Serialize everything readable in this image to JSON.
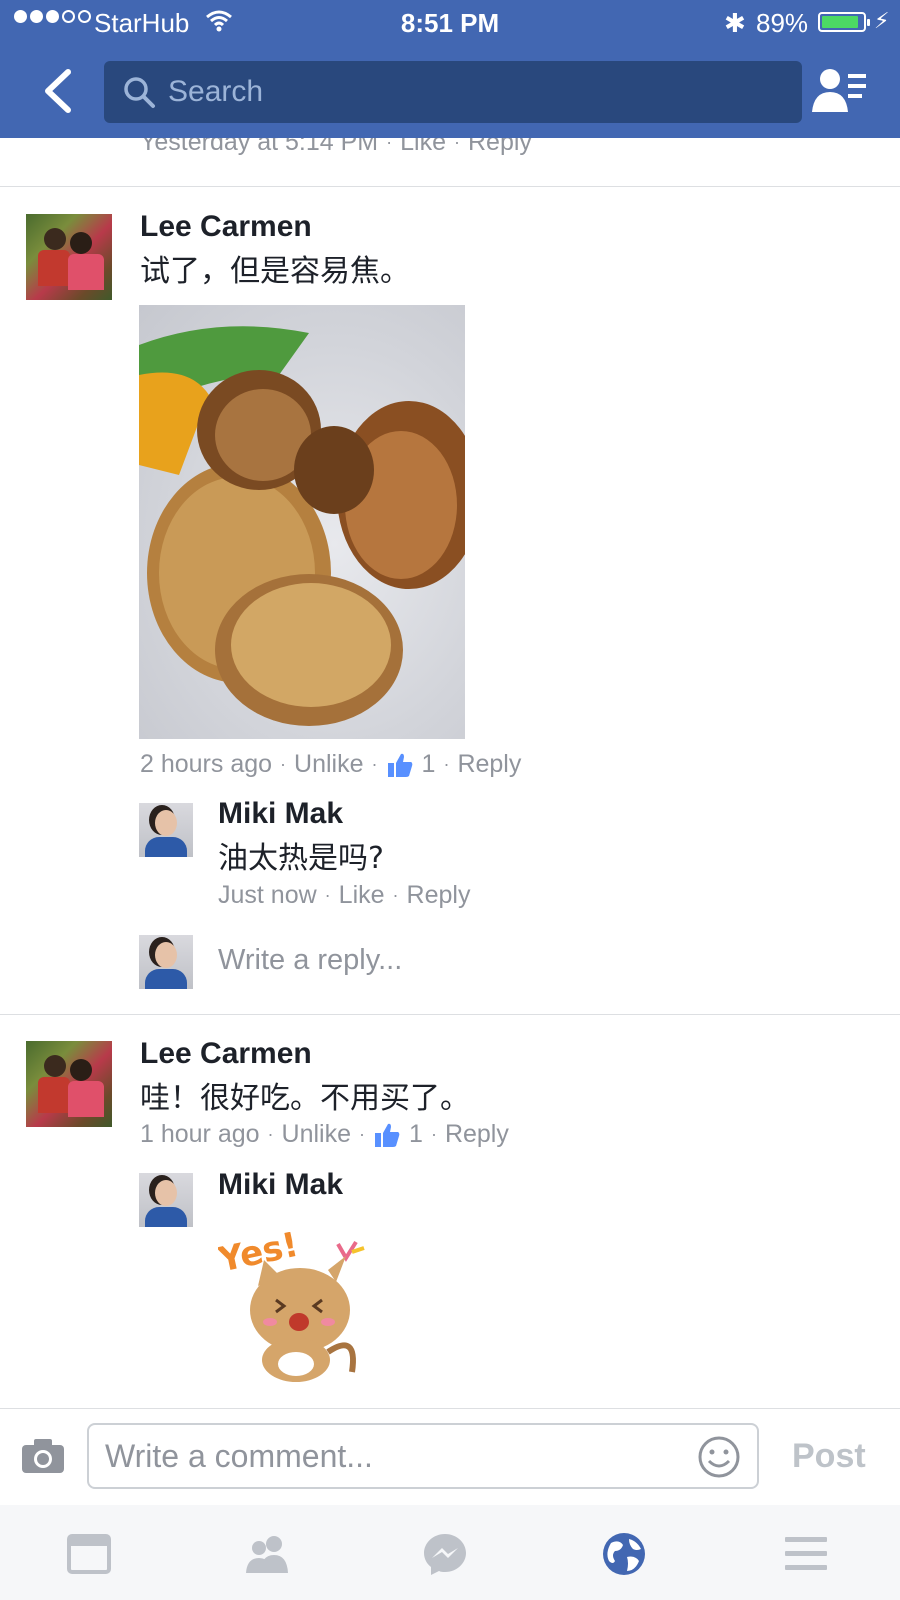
{
  "status_bar": {
    "carrier": "StarHub",
    "time": "8:51 PM",
    "battery_percent": "89%",
    "battery_level": 0.89,
    "signal_bars": 3,
    "signal_total": 5
  },
  "header": {
    "search_placeholder": "Search",
    "background_color": "#4267b2"
  },
  "previous_comment_meta": {
    "time": "Yesterday at 5:14 PM",
    "like": "Like",
    "reply": "Reply"
  },
  "comments": [
    {
      "author": "Lee Carmen",
      "text": "试了，但是容易焦。",
      "has_photo": true,
      "time": "2 hours ago",
      "like_action": "Unlike",
      "like_count": "1",
      "reply": "Reply",
      "replies": [
        {
          "author": "Miki Mak",
          "text": "油太热是吗?",
          "time": "Just now",
          "like_action": "Like",
          "reply": "Reply"
        }
      ],
      "write_reply_placeholder": "Write a reply..."
    },
    {
      "author": "Lee Carmen",
      "text": "哇！很好吃。不用买了。",
      "time": "1 hour ago",
      "like_action": "Unlike",
      "like_count": "1",
      "reply": "Reply",
      "replies": [
        {
          "author": "Miki Mak",
          "sticker": "cat-yes-sticker",
          "sticker_text": "Yes!"
        }
      ]
    }
  ],
  "composer": {
    "placeholder": "Write a comment...",
    "post_label": "Post"
  },
  "tabbar": {
    "items": [
      "news-feed-icon",
      "friends-icon",
      "messenger-icon",
      "notifications-globe-icon",
      "menu-icon"
    ],
    "active_index": 3,
    "active_color": "#4267b2",
    "inactive_color": "#bec2c9"
  }
}
